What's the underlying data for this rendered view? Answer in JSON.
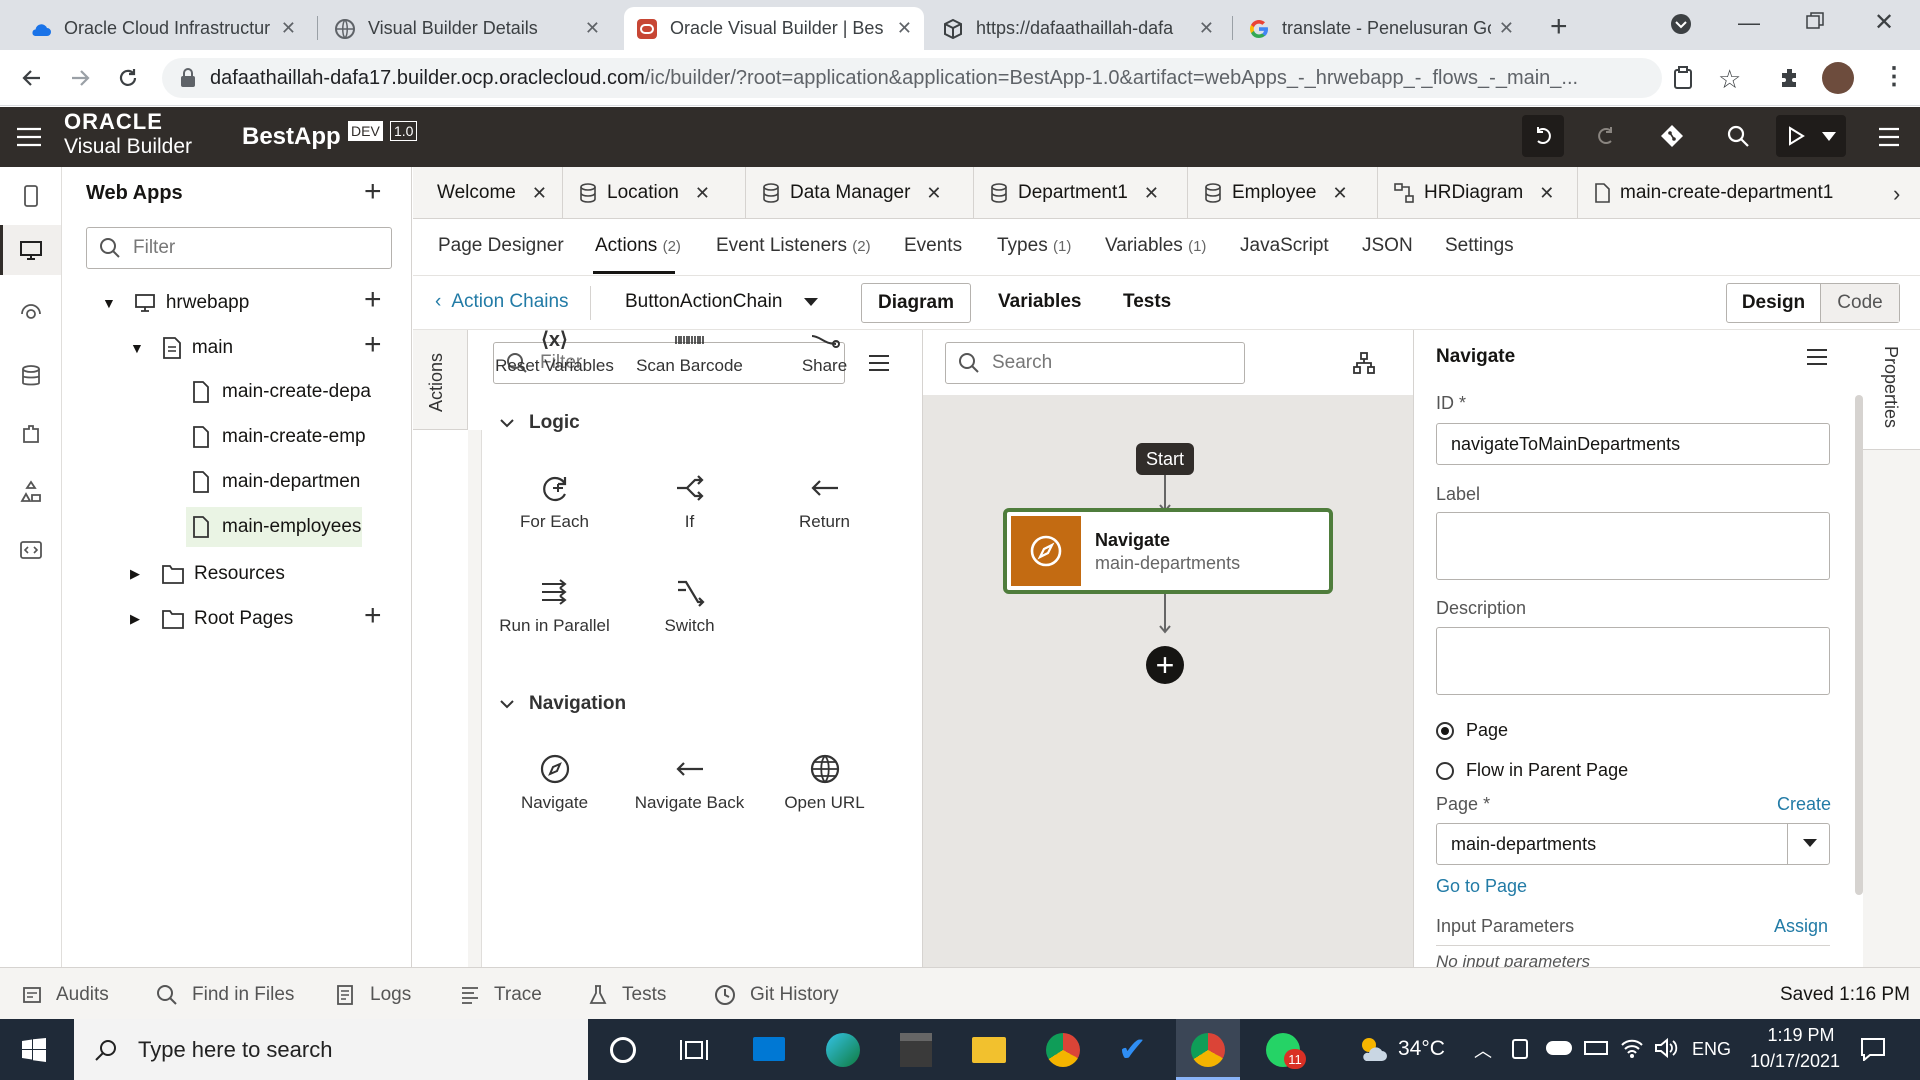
{
  "browser": {
    "tabs": [
      {
        "title": "Oracle Cloud Infrastructur"
      },
      {
        "title": "Visual Builder Details"
      },
      {
        "title": "Oracle Visual Builder | Bes"
      },
      {
        "title": "https://dafaathaillah-dafa"
      },
      {
        "title": "translate - Penelusuran Go"
      }
    ],
    "url_host": "dafaathaillah-dafa17.builder.ocp.oraclecloud.com",
    "url_path": "/ic/builder/?root=application&application=BestApp-1.0&artifact=webApps_-_hrwebapp_-_flows_-_main_..."
  },
  "header": {
    "brand_line1": "ORACLE",
    "brand_line2": "Visual Builder",
    "app_name": "BestApp",
    "badge_env": "DEV",
    "badge_version": "1.0"
  },
  "navigator": {
    "title": "Web Apps",
    "filter_placeholder": "Filter",
    "webapp": "hrwebapp",
    "flow": "main",
    "pages": [
      "main-create-depa",
      "main-create-emp",
      "main-departmen",
      "main-employees"
    ],
    "resources": "Resources",
    "root_pages": "Root Pages"
  },
  "doc_tabs": [
    "Welcome",
    "Location",
    "Data Manager",
    "Department1",
    "Employee",
    "HRDiagram",
    "main-create-department1"
  ],
  "sub_tabs": {
    "page_designer": "Page Designer",
    "actions": "Actions",
    "actions_count": "(2)",
    "event_listeners": "Event Listeners",
    "event_listeners_count": "(2)",
    "events": "Events",
    "types": "Types",
    "types_count": "(1)",
    "variables": "Variables",
    "variables_count": "(1)",
    "javascript": "JavaScript",
    "json": "JSON",
    "settings": "Settings"
  },
  "chain_bar": {
    "back_label": "Action Chains",
    "chain_name": "ButtonActionChain",
    "diagram": "Diagram",
    "variables": "Variables",
    "tests": "Tests",
    "design": "Design",
    "code": "Code"
  },
  "palette": {
    "side_label": "Actions",
    "filter_placeholder": "Filter",
    "top_items": [
      "Reset Variables",
      "Scan Barcode",
      "Share"
    ],
    "logic_title": "Logic",
    "logic_items": [
      "For Each",
      "If",
      "Return",
      "Run in Parallel",
      "Switch"
    ],
    "navigation_title": "Navigation",
    "navigation_items": [
      "Navigate",
      "Navigate Back",
      "Open URL"
    ]
  },
  "canvas": {
    "search_placeholder": "Search",
    "start_label": "Start",
    "node_title": "Navigate",
    "node_subtitle": "main-departments"
  },
  "properties": {
    "title": "Navigate",
    "side_tab": "Properties",
    "id_label": "ID",
    "required_mark": "*",
    "id_value": "navigateToMainDepartments",
    "label_label": "Label",
    "label_value": "",
    "description_label": "Description",
    "description_value": "",
    "radio_page": "Page",
    "radio_flow": "Flow in Parent Page",
    "radio_selected": "Page",
    "page_label": "Page",
    "create_link": "Create",
    "page_value": "main-departments",
    "go_to_page": "Go to Page",
    "input_params_label": "Input Parameters",
    "assign_link": "Assign",
    "no_params": "No input parameters"
  },
  "status_bar": {
    "items": [
      "Audits",
      "Find in Files",
      "Logs",
      "Trace",
      "Tests",
      "Git History"
    ],
    "saved": "Saved 1:16 PM"
  },
  "taskbar": {
    "search_placeholder": "Type here to search",
    "weather": "34°C",
    "language": "ENG",
    "time": "1:19 PM",
    "date": "10/17/2021",
    "whatsapp_badge": "11"
  },
  "colors": {
    "header_bg": "#312d2a",
    "node_icon_bg": "#c36b12",
    "node_border": "#4f7d3c",
    "link": "#227ba6",
    "selected_page_bg": "#eaf4e4"
  }
}
